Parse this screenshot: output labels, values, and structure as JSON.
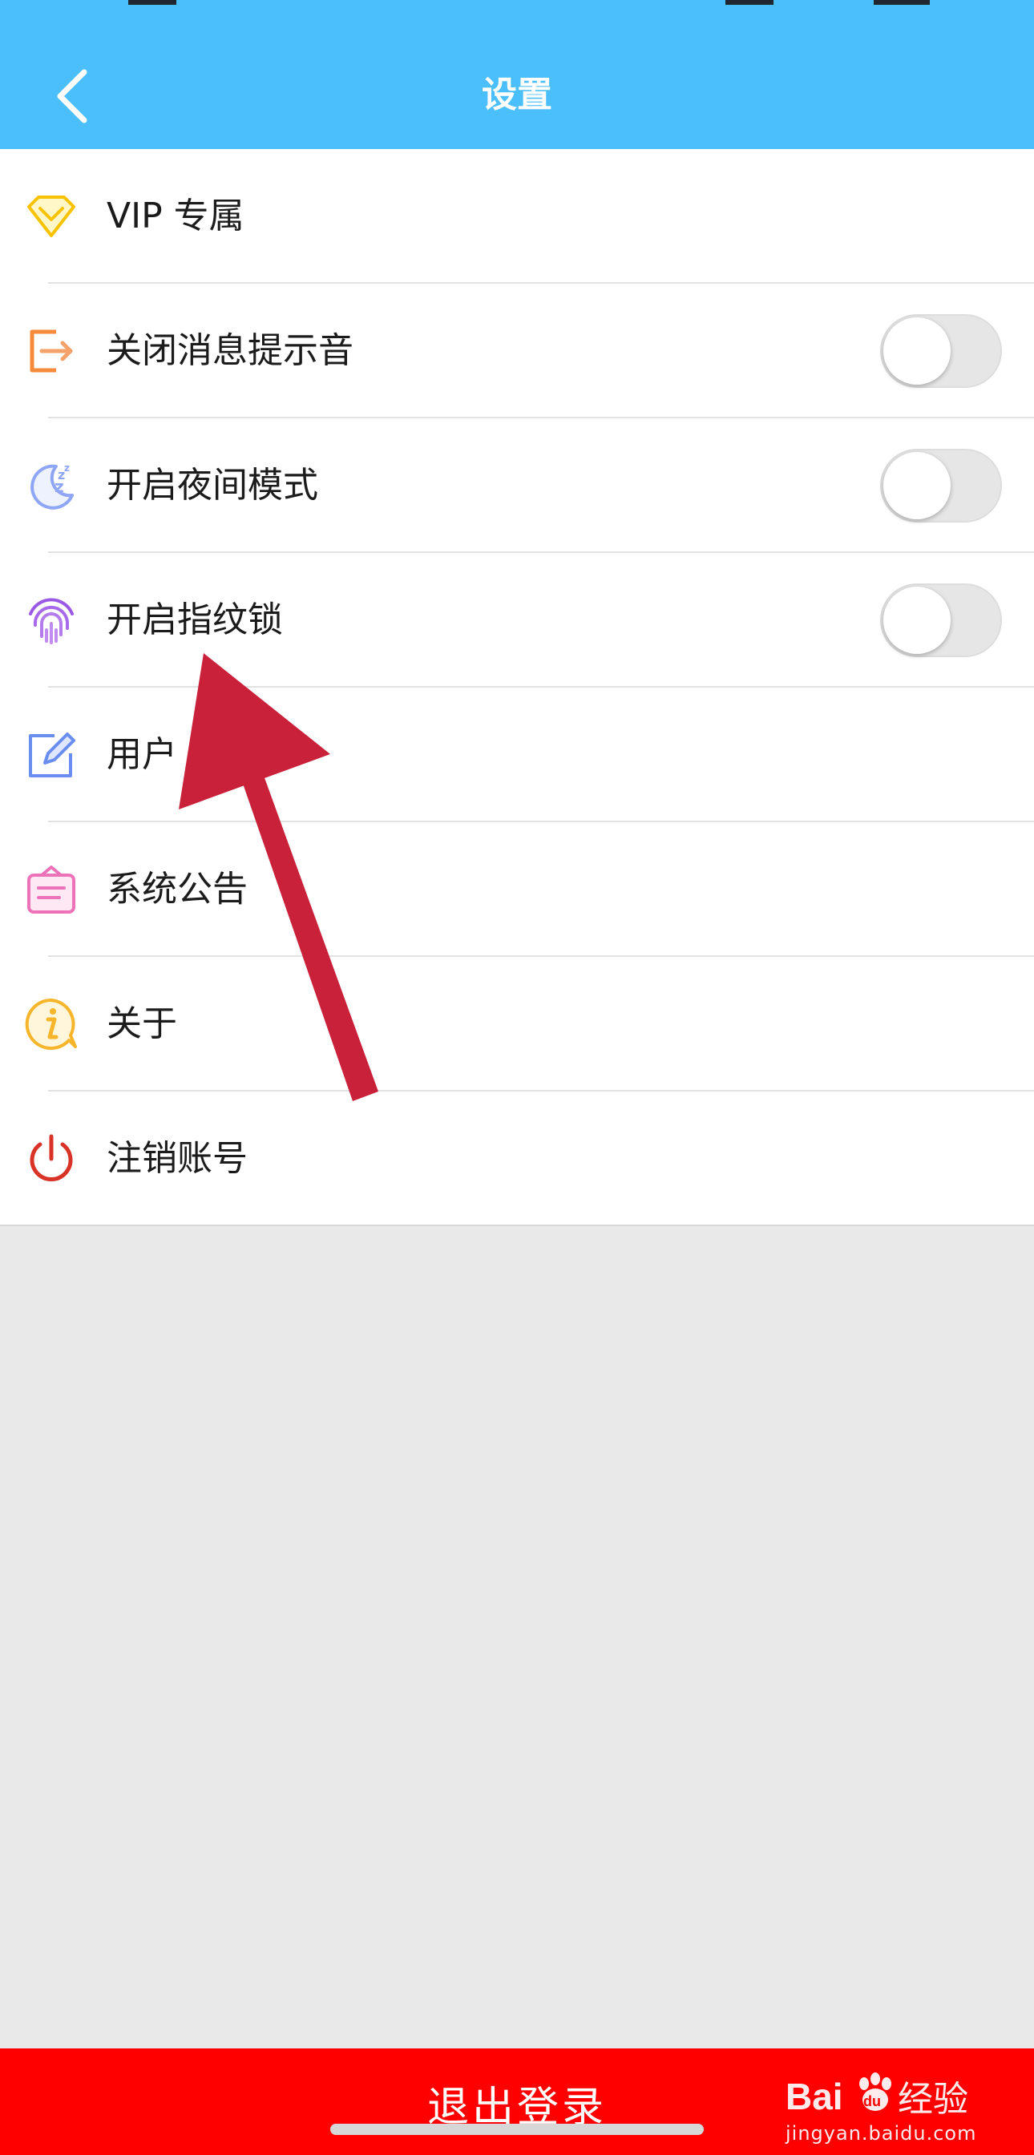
{
  "header": {
    "title": "设置",
    "background": "#4bbffb"
  },
  "settings": [
    {
      "id": "vip",
      "label": "VIP 专属",
      "icon": "diamond-icon",
      "color": "#f7c300",
      "has_toggle": false
    },
    {
      "id": "mute-notification-sound",
      "label": "关闭消息提示音",
      "icon": "exit-icon",
      "color": "#f58a3a",
      "has_toggle": true,
      "enabled": false
    },
    {
      "id": "night-mode",
      "label": "开启夜间模式",
      "icon": "moon-sleep-icon",
      "color": "#8ea6f5",
      "has_toggle": true,
      "enabled": false
    },
    {
      "id": "fingerprint-lock",
      "label": "开启指纹锁",
      "icon": "fingerprint-icon",
      "color": "#9a5ae6",
      "has_toggle": true,
      "enabled": false
    },
    {
      "id": "user-agreement",
      "label": "用户",
      "icon": "edit-icon",
      "color": "#6a8df0",
      "has_toggle": false
    },
    {
      "id": "system-announcement",
      "label": "系统公告",
      "icon": "notice-board-icon",
      "color": "#ee72b9",
      "has_toggle": false
    },
    {
      "id": "about",
      "label": "关于",
      "icon": "info-bubble-icon",
      "color": "#f6b52a",
      "has_toggle": false
    },
    {
      "id": "delete-account",
      "label": "注销账号",
      "icon": "power-icon",
      "color": "#d93226",
      "has_toggle": false
    }
  ],
  "logout": {
    "label": "退出登录",
    "background": "#ff0000"
  },
  "watermark": {
    "brand": "Bai 经验",
    "domain": "jingyan.baidu.com"
  },
  "annotation": {
    "type": "arrow",
    "color": "#c9213a",
    "points_to": "fingerprint-lock"
  }
}
